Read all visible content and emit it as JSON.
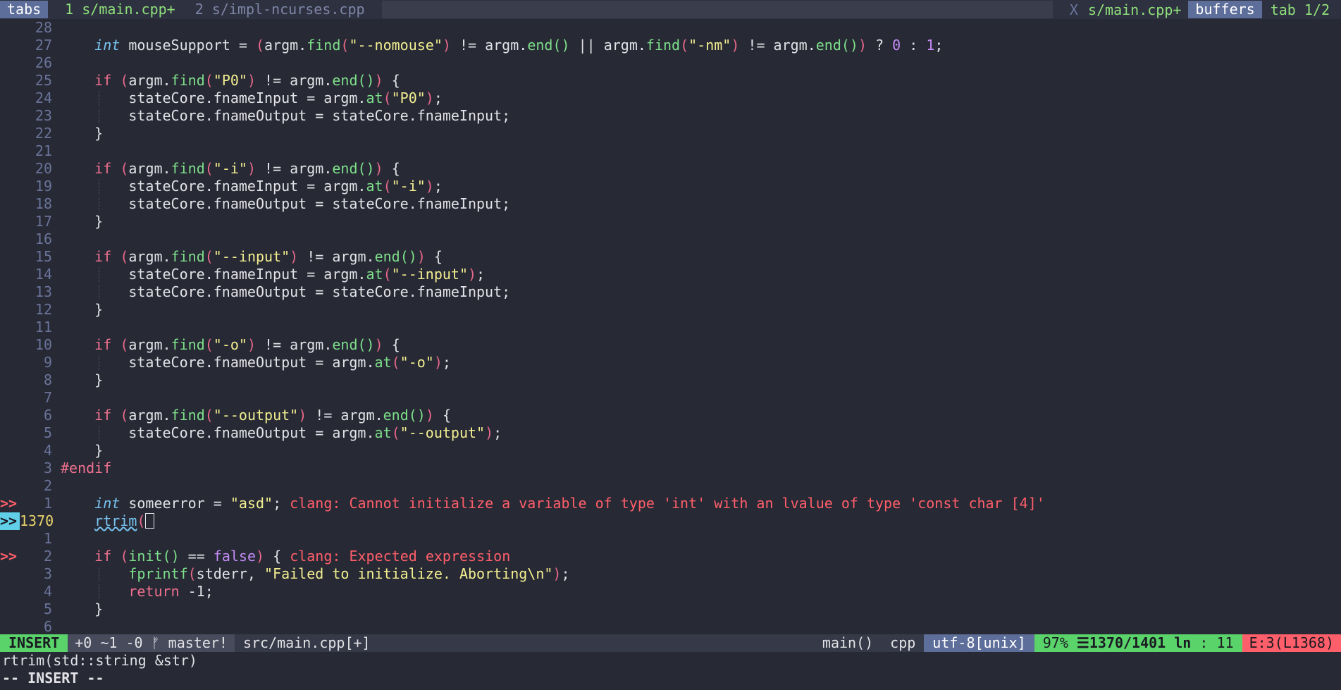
{
  "tabline": {
    "tabs_label": "tabs",
    "tab_active": "1 s/main.cpp+",
    "tab_inactive": "2 s/impl-ncurses.cpp",
    "close": "X",
    "current_file": "s/main.cpp+",
    "buffers_label": "buffers",
    "tab_count": "tab 1/2"
  },
  "editor": {
    "line_numbers": [
      "28",
      "27",
      "26",
      "25",
      "24",
      "23",
      "22",
      "21",
      "20",
      "19",
      "18",
      "17",
      "16",
      "15",
      "14",
      "13",
      "12",
      "11",
      "10",
      "9",
      "8",
      "7",
      "6",
      "5",
      "4",
      "3",
      "2",
      "1",
      "1370",
      "1",
      "2",
      "3",
      "4",
      "5",
      "6"
    ],
    "signs": {
      "27": ">>",
      "28": ">>",
      "30": ">>"
    },
    "strings": {
      "nomouse": "\"--nomouse\"",
      "nm": "\"-nm\"",
      "p0": "\"P0\"",
      "dash_i": "\"-i\"",
      "input": "\"--input\"",
      "dash_o": "\"-o\"",
      "output": "\"--output\"",
      "asd": "\"asd\"",
      "abort_msg": "\"Failed to initialize. Aborting\\n\""
    },
    "numbers": {
      "zero": "0",
      "one": "1",
      "neg_one": "-1"
    },
    "diagnostics": {
      "error1": "clang: Cannot initialize a variable of type 'int' with an lvalue of type 'const char [4]'",
      "error2": "clang: Expected expression"
    }
  },
  "statusline": {
    "mode": "INSERT",
    "git": "+0 ~1 -0 ᚠ master!",
    "file": "src/main.cpp[+]",
    "function": "main()",
    "filetype": "cpp",
    "encoding": "utf-8[unix]",
    "percent": "97%",
    "position": "☰1370/1401",
    "ln": "ln",
    "col": ": 11",
    "errors": "E:3(L1368)"
  },
  "cmdline": {
    "signature": "rtrim(std::string &str)",
    "mode_msg": "-- INSERT --"
  },
  "colors": {
    "background": "#272935",
    "accent_green": "#5ad46a",
    "error_red": "#ff5f6a",
    "tab_blue": "#5d6e9a"
  }
}
